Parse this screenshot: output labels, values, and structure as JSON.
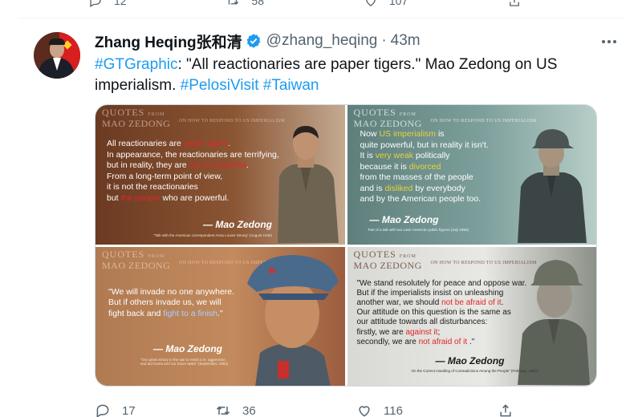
{
  "previous_tweet": {
    "reply_count": "12",
    "retweet_count": "58",
    "like_count": "107"
  },
  "tweet": {
    "author_name": "Zhang Heqing张和清",
    "handle": "@zhang_heqing",
    "separator": "·",
    "time": "43m",
    "text_parts": {
      "hashtag_graphic": "#GTGraphic",
      "body": ": \"All reactionaries are paper tigers.\" Mao Zedong on US imperialism. ",
      "hashtag_pelosi": "#PelosiVisit",
      "space": " ",
      "hashtag_taiwan": "#Taiwan"
    },
    "stats": {
      "replies": "17",
      "retweets": "36",
      "likes": "116"
    }
  },
  "images": [
    {
      "brand_quotes": "QUOTES",
      "brand_from": "FROM",
      "brand_mao": "MAO ZEDONG",
      "brand_sub": "ON HOW TO RESPOND TO US IMPERIALISM",
      "lines": [
        [
          "All reactionaries are ",
          "paper tigers",
          "."
        ],
        [
          "In appearance, the reactionaries are terrifying,"
        ],
        [
          "but in reality, they are ",
          "not so powerful",
          "."
        ],
        [
          "From a long-term point of view,"
        ],
        [
          "it is not the reactionaries"
        ],
        [
          "but ",
          "the people",
          " who are powerful."
        ]
      ],
      "author": "— Mao Zedong",
      "source": "\"Talk with the American correspondent Anna Louise Strong\" (August 1946)"
    },
    {
      "brand_quotes": "QUOTES",
      "brand_from": "FROM",
      "brand_mao": "MAO ZEDONG",
      "brand_sub": "ON HOW TO RESPOND TO US IMPERIALISM",
      "lines": [
        [
          "Now ",
          "US imperialism",
          " is"
        ],
        [
          "quite powerful, but in reality it isn't."
        ],
        [
          "It is ",
          "very weak",
          " politically"
        ],
        [
          "because it is ",
          "divorced"
        ],
        [
          "from the masses of the people"
        ],
        [
          "and is ",
          "disliked",
          " by everybody"
        ],
        [
          "and by the American people too."
        ]
      ],
      "author": "— Mao Zedong",
      "source": "Part of a talk with two Latin-American public figures (July 1956)"
    },
    {
      "brand_quotes": "QUOTES",
      "brand_from": "FROM",
      "brand_mao": "MAO ZEDONG",
      "brand_sub": "ON HOW TO RESPOND TO US IMPERIALISM",
      "lines": [
        [
          "\"We will invade no one anywhere."
        ],
        [
          "But if others invade us, we will"
        ],
        [
          "fight back and ",
          "fight to a finish",
          ".\""
        ]
      ],
      "author": "— Mao Zedong",
      "source_line1": "\"Our great victory in the war to resist U.S. aggression",
      "source_line2": "and aid Korea and our future tasks\" (September, 1953)"
    },
    {
      "brand_quotes": "QUOTES",
      "brand_from": "FROM",
      "brand_mao": "MAO ZEDONG",
      "brand_sub": "ON HOW TO RESPOND TO US IMPERIALISM",
      "lines": [
        [
          "\"We stand resolutely for peace and oppose war."
        ],
        [
          "But if the imperialists insist on unleashing"
        ],
        [
          "another war, we should ",
          "not be afraid of it",
          "."
        ],
        [
          "Our attitude on this question is the same as"
        ],
        [
          "our attitude towards all disturbances:"
        ],
        [
          "firstly, we are ",
          "against it",
          ";"
        ],
        [
          "secondly, we are ",
          "not afraid of it",
          " .\""
        ]
      ],
      "author": "— Mao Zedong",
      "source": "On the Correct Handling of Contradictions Among the People\" (February, 1957)"
    }
  ],
  "colors": {
    "link": "#1d9bf0",
    "secondary_text": "#536471",
    "highlight_red": "#e0262a",
    "highlight_yellow": "#e8d436",
    "highlight_blue": "#a8d0ff"
  }
}
